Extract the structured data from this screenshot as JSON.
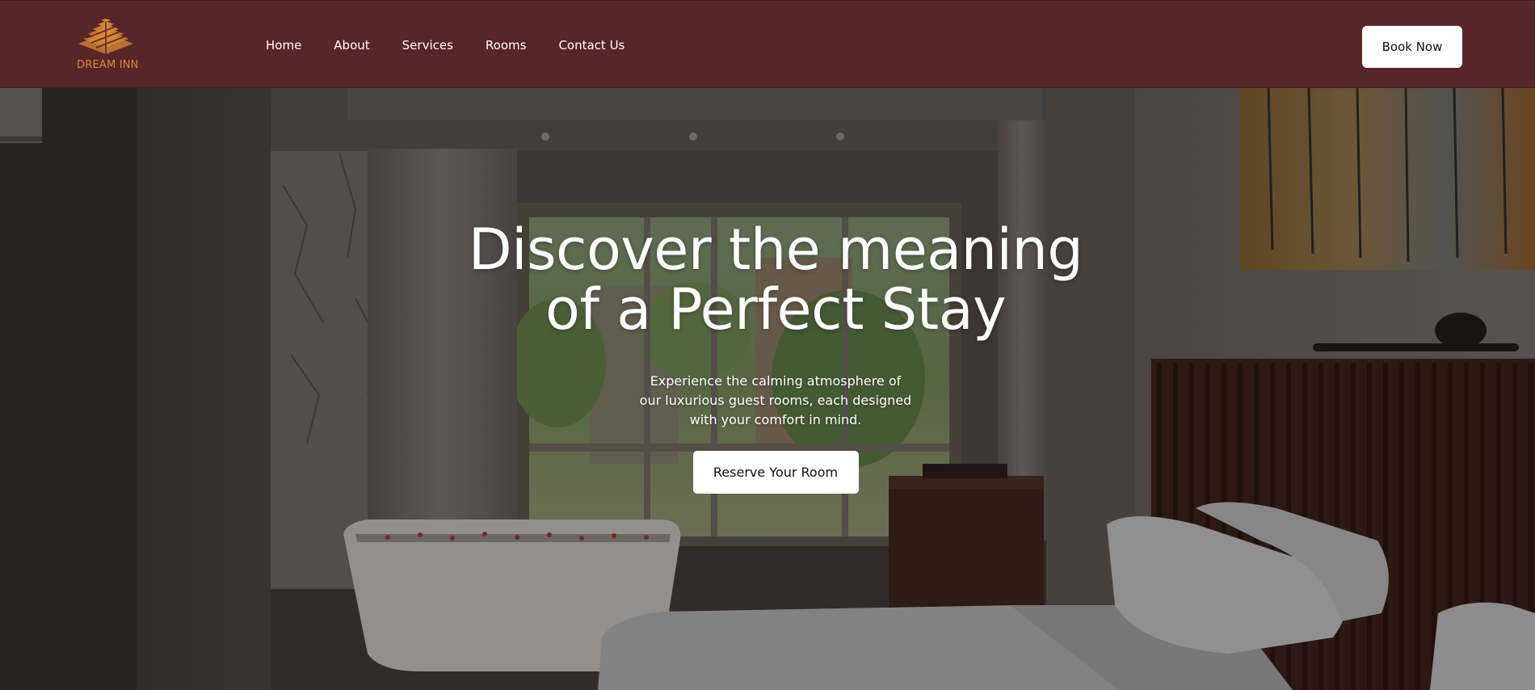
{
  "header": {
    "logo_text": "DREAM INN",
    "nav": [
      "Home",
      "About",
      "Services",
      "Rooms",
      "Contact Us"
    ],
    "cta_label": "Book Now"
  },
  "hero": {
    "title_line1": "Discover the meaning",
    "title_line2": "of a Perfect Stay",
    "subtitle_line1": "Experience the calming atmosphere of",
    "subtitle_line2": "our luxurious guest rooms, each designed",
    "subtitle_line3": "with your comfort in mind.",
    "cta_label": "Reserve Your Room",
    "background_image": "hotel-room-photo"
  },
  "colors": {
    "header_bg": "#582529",
    "logo_gold": "#d98a35",
    "button_bg": "#ffffff",
    "text_light": "#ffffff"
  }
}
